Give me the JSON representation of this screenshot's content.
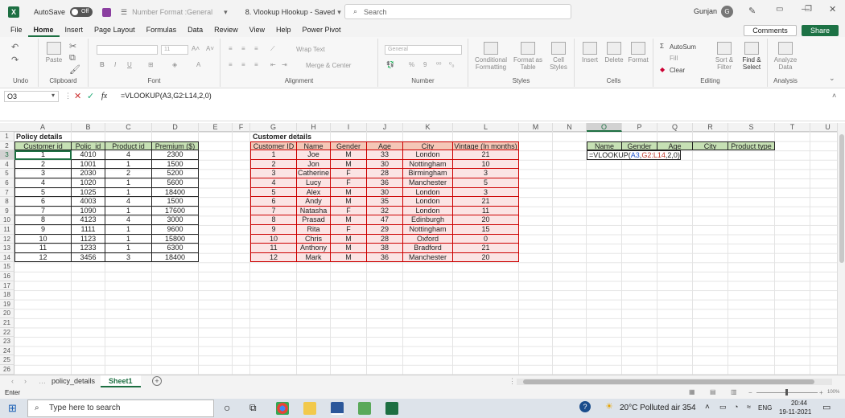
{
  "titlebar": {
    "autosave_label": "AutoSave",
    "autosave_state": "Off",
    "number_format": "Number Format :General",
    "doc_title": "8. Vlookup Hlookup  -  Saved",
    "search_placeholder": "Search",
    "user_name": "Gunjan",
    "user_initial": "G"
  },
  "menu": {
    "items": [
      "File",
      "Home",
      "Insert",
      "Page Layout",
      "Formulas",
      "Data",
      "Review",
      "View",
      "Help",
      "Power Pivot"
    ],
    "comments_label": "Comments",
    "share_label": "Share"
  },
  "ribbon": {
    "groups": [
      "Undo",
      "Clipboard",
      "Font",
      "Alignment",
      "Number",
      "Styles",
      "Cells",
      "Editing",
      "Analysis"
    ],
    "paste": "Paste",
    "font_size": "11",
    "wrap_text": "Wrap Text",
    "merge_center": "Merge & Center",
    "number_format_box": "General",
    "conditional": "Conditional Formatting",
    "format_table": "Format as Table",
    "cell_styles": "Cell Styles",
    "insert": "Insert",
    "delete": "Delete",
    "format": "Format",
    "autosum": "AutoSum",
    "fill": "Fill",
    "clear": "Clear",
    "sort_filter": "Sort & Filter",
    "find_select": "Find & Select",
    "analyze": "Analyze Data"
  },
  "formula_bar": {
    "name_box": "O3",
    "formula": "=VLOOKUP(A3,G2:L14,2,0)",
    "fx": "fx"
  },
  "columns": [
    "A",
    "B",
    "C",
    "D",
    "E",
    "F",
    "G",
    "H",
    "I",
    "J",
    "K",
    "L",
    "M",
    "N",
    "O",
    "P",
    "Q",
    "R",
    "S",
    "T",
    "U"
  ],
  "rows": [
    "1",
    "2",
    "3",
    "4",
    "5",
    "6",
    "7",
    "8",
    "9",
    "10",
    "11",
    "12",
    "13",
    "14",
    "15",
    "16",
    "17",
    "18",
    "19",
    "20",
    "21",
    "22",
    "23",
    "24",
    "25",
    "26"
  ],
  "policy_table": {
    "title": "Policy details",
    "headers": [
      "Customer id",
      "Polic_id",
      "Product id",
      "Premium ($)"
    ],
    "rows": [
      [
        "1",
        "4010",
        "4",
        "2300"
      ],
      [
        "2",
        "1001",
        "1",
        "1500"
      ],
      [
        "3",
        "2030",
        "2",
        "5200"
      ],
      [
        "4",
        "1020",
        "1",
        "5600"
      ],
      [
        "5",
        "1025",
        "1",
        "18400"
      ],
      [
        "6",
        "4003",
        "4",
        "1500"
      ],
      [
        "7",
        "1090",
        "1",
        "17600"
      ],
      [
        "8",
        "4123",
        "4",
        "3000"
      ],
      [
        "9",
        "1111",
        "1",
        "9600"
      ],
      [
        "10",
        "1123",
        "1",
        "15800"
      ],
      [
        "11",
        "1233",
        "1",
        "6300"
      ],
      [
        "12",
        "3456",
        "3",
        "18400"
      ]
    ]
  },
  "customer_table": {
    "title": "Customer details",
    "headers": [
      "Customer ID",
      "Name",
      "Gender",
      "Age",
      "City",
      "Vintage (In months)"
    ],
    "rows": [
      [
        "1",
        "Joe",
        "M",
        "33",
        "London",
        "21"
      ],
      [
        "2",
        "Jon",
        "M",
        "30",
        "Nottingham",
        "10"
      ],
      [
        "3",
        "Catherine",
        "F",
        "28",
        "Birmingham",
        "3"
      ],
      [
        "4",
        "Lucy",
        "F",
        "36",
        "Manchester",
        "5"
      ],
      [
        "5",
        "Alex",
        "M",
        "30",
        "London",
        "3"
      ],
      [
        "6",
        "Andy",
        "M",
        "35",
        "London",
        "21"
      ],
      [
        "7",
        "Natasha",
        "F",
        "32",
        "London",
        "11"
      ],
      [
        "8",
        "Prasad",
        "M",
        "47",
        "Edinburgh",
        "20"
      ],
      [
        "9",
        "Rita",
        "F",
        "29",
        "Nottingham",
        "15"
      ],
      [
        "10",
        "Chris",
        "M",
        "28",
        "Oxford",
        "0"
      ],
      [
        "11",
        "Anthony",
        "M",
        "38",
        "Bradford",
        "21"
      ],
      [
        "12",
        "Mark",
        "M",
        "36",
        "Manchester",
        "20"
      ]
    ]
  },
  "lookup_table": {
    "headers": [
      "Name",
      "Gender",
      "Age",
      "City",
      "Product type"
    ],
    "editing_cell": "=VLOOKUP(A3,G2:L14,2,0)"
  },
  "sheets": {
    "tabs": [
      "policy_details",
      "Sheet1"
    ],
    "active": "Sheet1"
  },
  "status": {
    "mode": "Enter",
    "zoom": "100%"
  },
  "taskbar": {
    "search_placeholder": "Type here to search",
    "weather": "20°C  Polluted air 354",
    "lang": "ENG",
    "time": "20:44",
    "date": "19-11-2021"
  }
}
